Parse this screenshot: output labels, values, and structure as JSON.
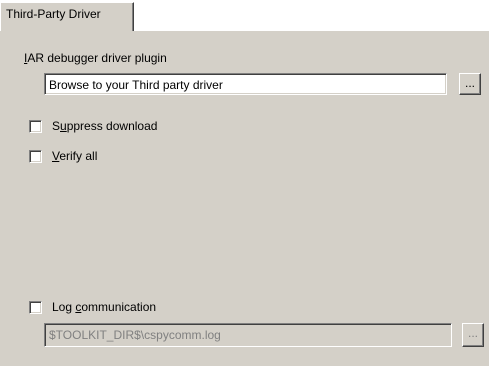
{
  "tab": {
    "label": "Third-Party Driver"
  },
  "plugin": {
    "label_mnemonic": "I",
    "label_rest": "AR debugger driver plugin",
    "value": "Browse to your Third party driver",
    "browse_label": "..."
  },
  "options": {
    "suppress_download": {
      "pre": "S",
      "mnemonic": "u",
      "post": "ppress download",
      "checked": false
    },
    "verify_all": {
      "mnemonic": "V",
      "post": "erify all",
      "checked": false
    }
  },
  "log": {
    "pre": "Log ",
    "mnemonic": "c",
    "post": "ommunication",
    "checked": false,
    "path": "$TOOLKIT_DIR$\\cspycomm.log",
    "browse_label": "..."
  }
}
